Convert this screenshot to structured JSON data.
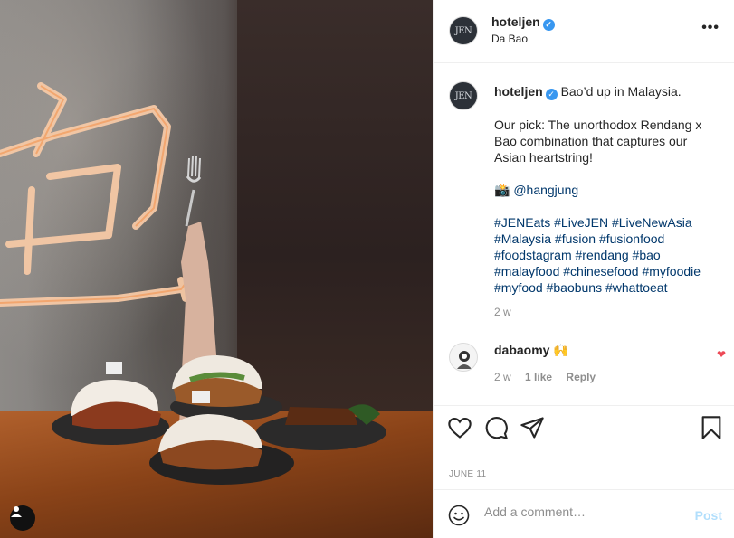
{
  "post": {
    "username": "hoteljen",
    "location": "Da Bao",
    "avatar_text": "JEN",
    "verified_icon": "verified-badge-icon",
    "more_label": "•••"
  },
  "caption": {
    "line1": "Bao’d up in Malaysia.",
    "line2": "Our pick: The unorthodox Rendang x Bao combination that captures our Asian heartstring!",
    "camera": "📸",
    "mention": "@hangjung",
    "hashtags": "#JENEats #LiveJEN #LiveNewAsia #Malaysia #fusion #fusionfood #foodstagram #rendang #bao #malayfood #chinesefood #myfoodie #myfood #baobuns #whattoeat",
    "time": "2 w"
  },
  "comment": {
    "username": "dabaomy",
    "text": "🙌",
    "time": "2 w",
    "likes": "1 like",
    "reply": "Reply"
  },
  "actions": {
    "date": "JUNE 11",
    "icons": [
      "heart-icon",
      "comment-icon",
      "share-icon",
      "bookmark-icon"
    ]
  },
  "add_comment": {
    "placeholder": "Add a comment…",
    "post_label": "Post"
  },
  "colors": {
    "link": "#00376b",
    "verified": "#3897f0",
    "like_red": "#ed4956",
    "post_disabled": "#b2dffc"
  }
}
